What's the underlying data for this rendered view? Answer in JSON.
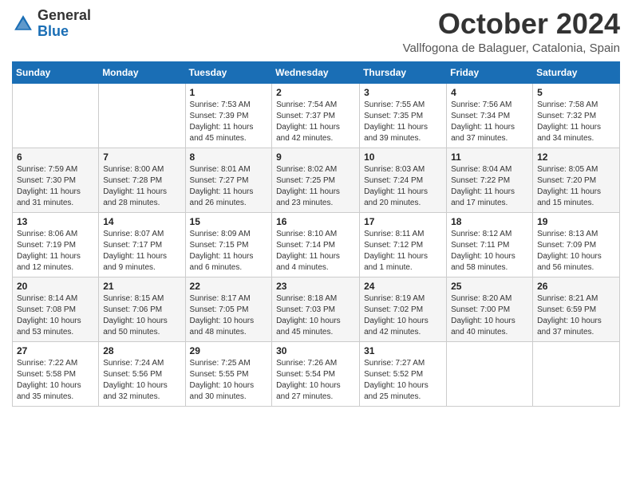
{
  "logo": {
    "general": "General",
    "blue": "Blue"
  },
  "title": "October 2024",
  "location": "Vallfogona de Balaguer, Catalonia, Spain",
  "days_of_week": [
    "Sunday",
    "Monday",
    "Tuesday",
    "Wednesday",
    "Thursday",
    "Friday",
    "Saturday"
  ],
  "weeks": [
    [
      {
        "num": "",
        "info": ""
      },
      {
        "num": "",
        "info": ""
      },
      {
        "num": "1",
        "info": "Sunrise: 7:53 AM\nSunset: 7:39 PM\nDaylight: 11 hours and 45 minutes."
      },
      {
        "num": "2",
        "info": "Sunrise: 7:54 AM\nSunset: 7:37 PM\nDaylight: 11 hours and 42 minutes."
      },
      {
        "num": "3",
        "info": "Sunrise: 7:55 AM\nSunset: 7:35 PM\nDaylight: 11 hours and 39 minutes."
      },
      {
        "num": "4",
        "info": "Sunrise: 7:56 AM\nSunset: 7:34 PM\nDaylight: 11 hours and 37 minutes."
      },
      {
        "num": "5",
        "info": "Sunrise: 7:58 AM\nSunset: 7:32 PM\nDaylight: 11 hours and 34 minutes."
      }
    ],
    [
      {
        "num": "6",
        "info": "Sunrise: 7:59 AM\nSunset: 7:30 PM\nDaylight: 11 hours and 31 minutes."
      },
      {
        "num": "7",
        "info": "Sunrise: 8:00 AM\nSunset: 7:28 PM\nDaylight: 11 hours and 28 minutes."
      },
      {
        "num": "8",
        "info": "Sunrise: 8:01 AM\nSunset: 7:27 PM\nDaylight: 11 hours and 26 minutes."
      },
      {
        "num": "9",
        "info": "Sunrise: 8:02 AM\nSunset: 7:25 PM\nDaylight: 11 hours and 23 minutes."
      },
      {
        "num": "10",
        "info": "Sunrise: 8:03 AM\nSunset: 7:24 PM\nDaylight: 11 hours and 20 minutes."
      },
      {
        "num": "11",
        "info": "Sunrise: 8:04 AM\nSunset: 7:22 PM\nDaylight: 11 hours and 17 minutes."
      },
      {
        "num": "12",
        "info": "Sunrise: 8:05 AM\nSunset: 7:20 PM\nDaylight: 11 hours and 15 minutes."
      }
    ],
    [
      {
        "num": "13",
        "info": "Sunrise: 8:06 AM\nSunset: 7:19 PM\nDaylight: 11 hours and 12 minutes."
      },
      {
        "num": "14",
        "info": "Sunrise: 8:07 AM\nSunset: 7:17 PM\nDaylight: 11 hours and 9 minutes."
      },
      {
        "num": "15",
        "info": "Sunrise: 8:09 AM\nSunset: 7:15 PM\nDaylight: 11 hours and 6 minutes."
      },
      {
        "num": "16",
        "info": "Sunrise: 8:10 AM\nSunset: 7:14 PM\nDaylight: 11 hours and 4 minutes."
      },
      {
        "num": "17",
        "info": "Sunrise: 8:11 AM\nSunset: 7:12 PM\nDaylight: 11 hours and 1 minute."
      },
      {
        "num": "18",
        "info": "Sunrise: 8:12 AM\nSunset: 7:11 PM\nDaylight: 10 hours and 58 minutes."
      },
      {
        "num": "19",
        "info": "Sunrise: 8:13 AM\nSunset: 7:09 PM\nDaylight: 10 hours and 56 minutes."
      }
    ],
    [
      {
        "num": "20",
        "info": "Sunrise: 8:14 AM\nSunset: 7:08 PM\nDaylight: 10 hours and 53 minutes."
      },
      {
        "num": "21",
        "info": "Sunrise: 8:15 AM\nSunset: 7:06 PM\nDaylight: 10 hours and 50 minutes."
      },
      {
        "num": "22",
        "info": "Sunrise: 8:17 AM\nSunset: 7:05 PM\nDaylight: 10 hours and 48 minutes."
      },
      {
        "num": "23",
        "info": "Sunrise: 8:18 AM\nSunset: 7:03 PM\nDaylight: 10 hours and 45 minutes."
      },
      {
        "num": "24",
        "info": "Sunrise: 8:19 AM\nSunset: 7:02 PM\nDaylight: 10 hours and 42 minutes."
      },
      {
        "num": "25",
        "info": "Sunrise: 8:20 AM\nSunset: 7:00 PM\nDaylight: 10 hours and 40 minutes."
      },
      {
        "num": "26",
        "info": "Sunrise: 8:21 AM\nSunset: 6:59 PM\nDaylight: 10 hours and 37 minutes."
      }
    ],
    [
      {
        "num": "27",
        "info": "Sunrise: 7:22 AM\nSunset: 5:58 PM\nDaylight: 10 hours and 35 minutes."
      },
      {
        "num": "28",
        "info": "Sunrise: 7:24 AM\nSunset: 5:56 PM\nDaylight: 10 hours and 32 minutes."
      },
      {
        "num": "29",
        "info": "Sunrise: 7:25 AM\nSunset: 5:55 PM\nDaylight: 10 hours and 30 minutes."
      },
      {
        "num": "30",
        "info": "Sunrise: 7:26 AM\nSunset: 5:54 PM\nDaylight: 10 hours and 27 minutes."
      },
      {
        "num": "31",
        "info": "Sunrise: 7:27 AM\nSunset: 5:52 PM\nDaylight: 10 hours and 25 minutes."
      },
      {
        "num": "",
        "info": ""
      },
      {
        "num": "",
        "info": ""
      }
    ]
  ]
}
